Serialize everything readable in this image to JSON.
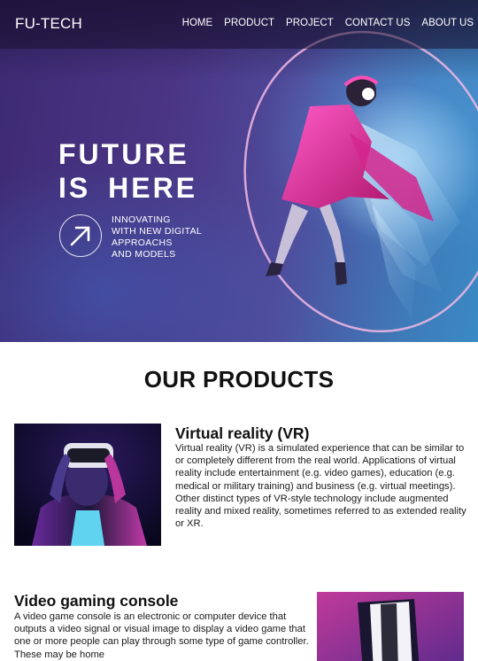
{
  "nav": {
    "logo": "FU-TECH",
    "links": [
      "HOME",
      "PRODUCT",
      "PROJECT",
      "CONTACT US",
      "ABOUT US"
    ]
  },
  "hero": {
    "title_line1": "FUTURE",
    "title_line2": "IS HERE",
    "tagline": [
      "INNOVATING",
      "WITH NEW DIGITAL",
      "APPROACHS",
      "AND MODELS"
    ],
    "arrow_icon": "arrow-up-right-icon"
  },
  "products": {
    "heading": "OUR PRODUCTS",
    "items": [
      {
        "title": "Virtual reality (VR)",
        "description": "Virtual reality (VR) is a simulated experience that can be similar to or completely different from the real world. Applications of virtual reality include entertainment (e.g. video games), education (e.g. medical or military training) and business (e.g. virtual meetings). Other distinct types of VR-style technology include augmented reality and mixed reality, sometimes referred to as extended reality or XR."
      },
      {
        "title": "Video gaming console",
        "description": "A video game console is an electronic or computer device that outputs a video signal or visual image to display a video game that one or more people can play through some type of game controller. These may be home"
      }
    ]
  },
  "colors": {
    "hero_start": "#3d2a73",
    "hero_end": "#3a8ac4",
    "accent_pink": "#e0309a",
    "text": "#111111"
  }
}
